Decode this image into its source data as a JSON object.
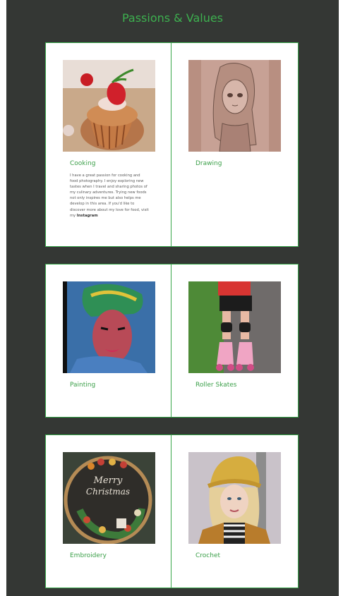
{
  "header": {
    "title": "Passions & Values"
  },
  "colors": {
    "background": "#343734",
    "accent": "#3db04f",
    "card_border": "#38a74b"
  },
  "cards": [
    {
      "title": "Cooking",
      "description": "I have a great passion for cooking and food photography. I enjoy exploring new tastes when I travel and sharing photos of my culinary adventures. Trying new foods not only inspires me but also helps me develop in this area. If you'd like to discover more about my love for food, visit my ",
      "link_text": "Instagram",
      "image": "cupcake with strawberry photo"
    },
    {
      "title": "Drawing",
      "image": "pencil anime girl sketch"
    },
    {
      "title": "Painting",
      "image": "portrait painting of woman with head wrap"
    },
    {
      "title": "Roller Skates",
      "image": "legs in pink roller skates"
    },
    {
      "title": "Embroidery",
      "image": "Merry Christmas embroidery hoop"
    },
    {
      "title": "Crochet",
      "image": "woman wearing yellow crochet hat"
    }
  ]
}
